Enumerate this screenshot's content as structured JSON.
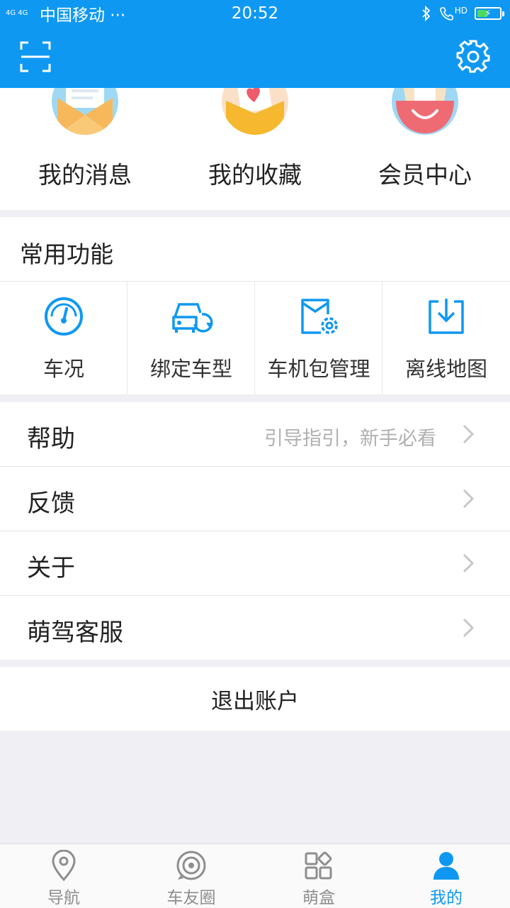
{
  "status_bar": {
    "signal": "4G 4G",
    "carrier": "中国移动 ···",
    "time": "20:52",
    "right_icons": [
      "bluetooth-icon",
      "hd-call-icon",
      "battery-icon"
    ],
    "hd": "HD",
    "battery_level": 0.45,
    "battery_color": "#4CD964"
  },
  "theme": {
    "primary": "#0E98F2",
    "background": "#EFEFF4"
  },
  "app_bar": {
    "left_icon": "scan-icon",
    "right_icon": "settings-icon"
  },
  "quick_actions": [
    {
      "label": "我的消息",
      "icon": "message-envelope-icon"
    },
    {
      "label": "我的收藏",
      "icon": "favorite-heart-envelope-icon"
    },
    {
      "label": "会员中心",
      "icon": "member-smile-icon"
    }
  ],
  "common_functions": {
    "title": "常用功能",
    "items": [
      {
        "label": "车况",
        "icon": "gauge-icon"
      },
      {
        "label": "绑定车型",
        "icon": "car-sync-icon"
      },
      {
        "label": "车机包管理",
        "icon": "package-settings-icon"
      },
      {
        "label": "离线地图",
        "icon": "download-icon"
      }
    ]
  },
  "menu": [
    {
      "label": "帮助",
      "hint": "引导指引，新手必看"
    },
    {
      "label": "反馈",
      "hint": ""
    },
    {
      "label": "关于",
      "hint": ""
    },
    {
      "label": "萌驾客服",
      "hint": ""
    }
  ],
  "logout_label": "退出账户",
  "tabbar": {
    "active_index": 3,
    "items": [
      {
        "label": "导航",
        "icon": "location-pin-icon"
      },
      {
        "label": "车友圈",
        "icon": "community-ring-icon"
      },
      {
        "label": "萌盒",
        "icon": "app-grid-icon"
      },
      {
        "label": "我的",
        "icon": "user-profile-icon"
      }
    ]
  }
}
